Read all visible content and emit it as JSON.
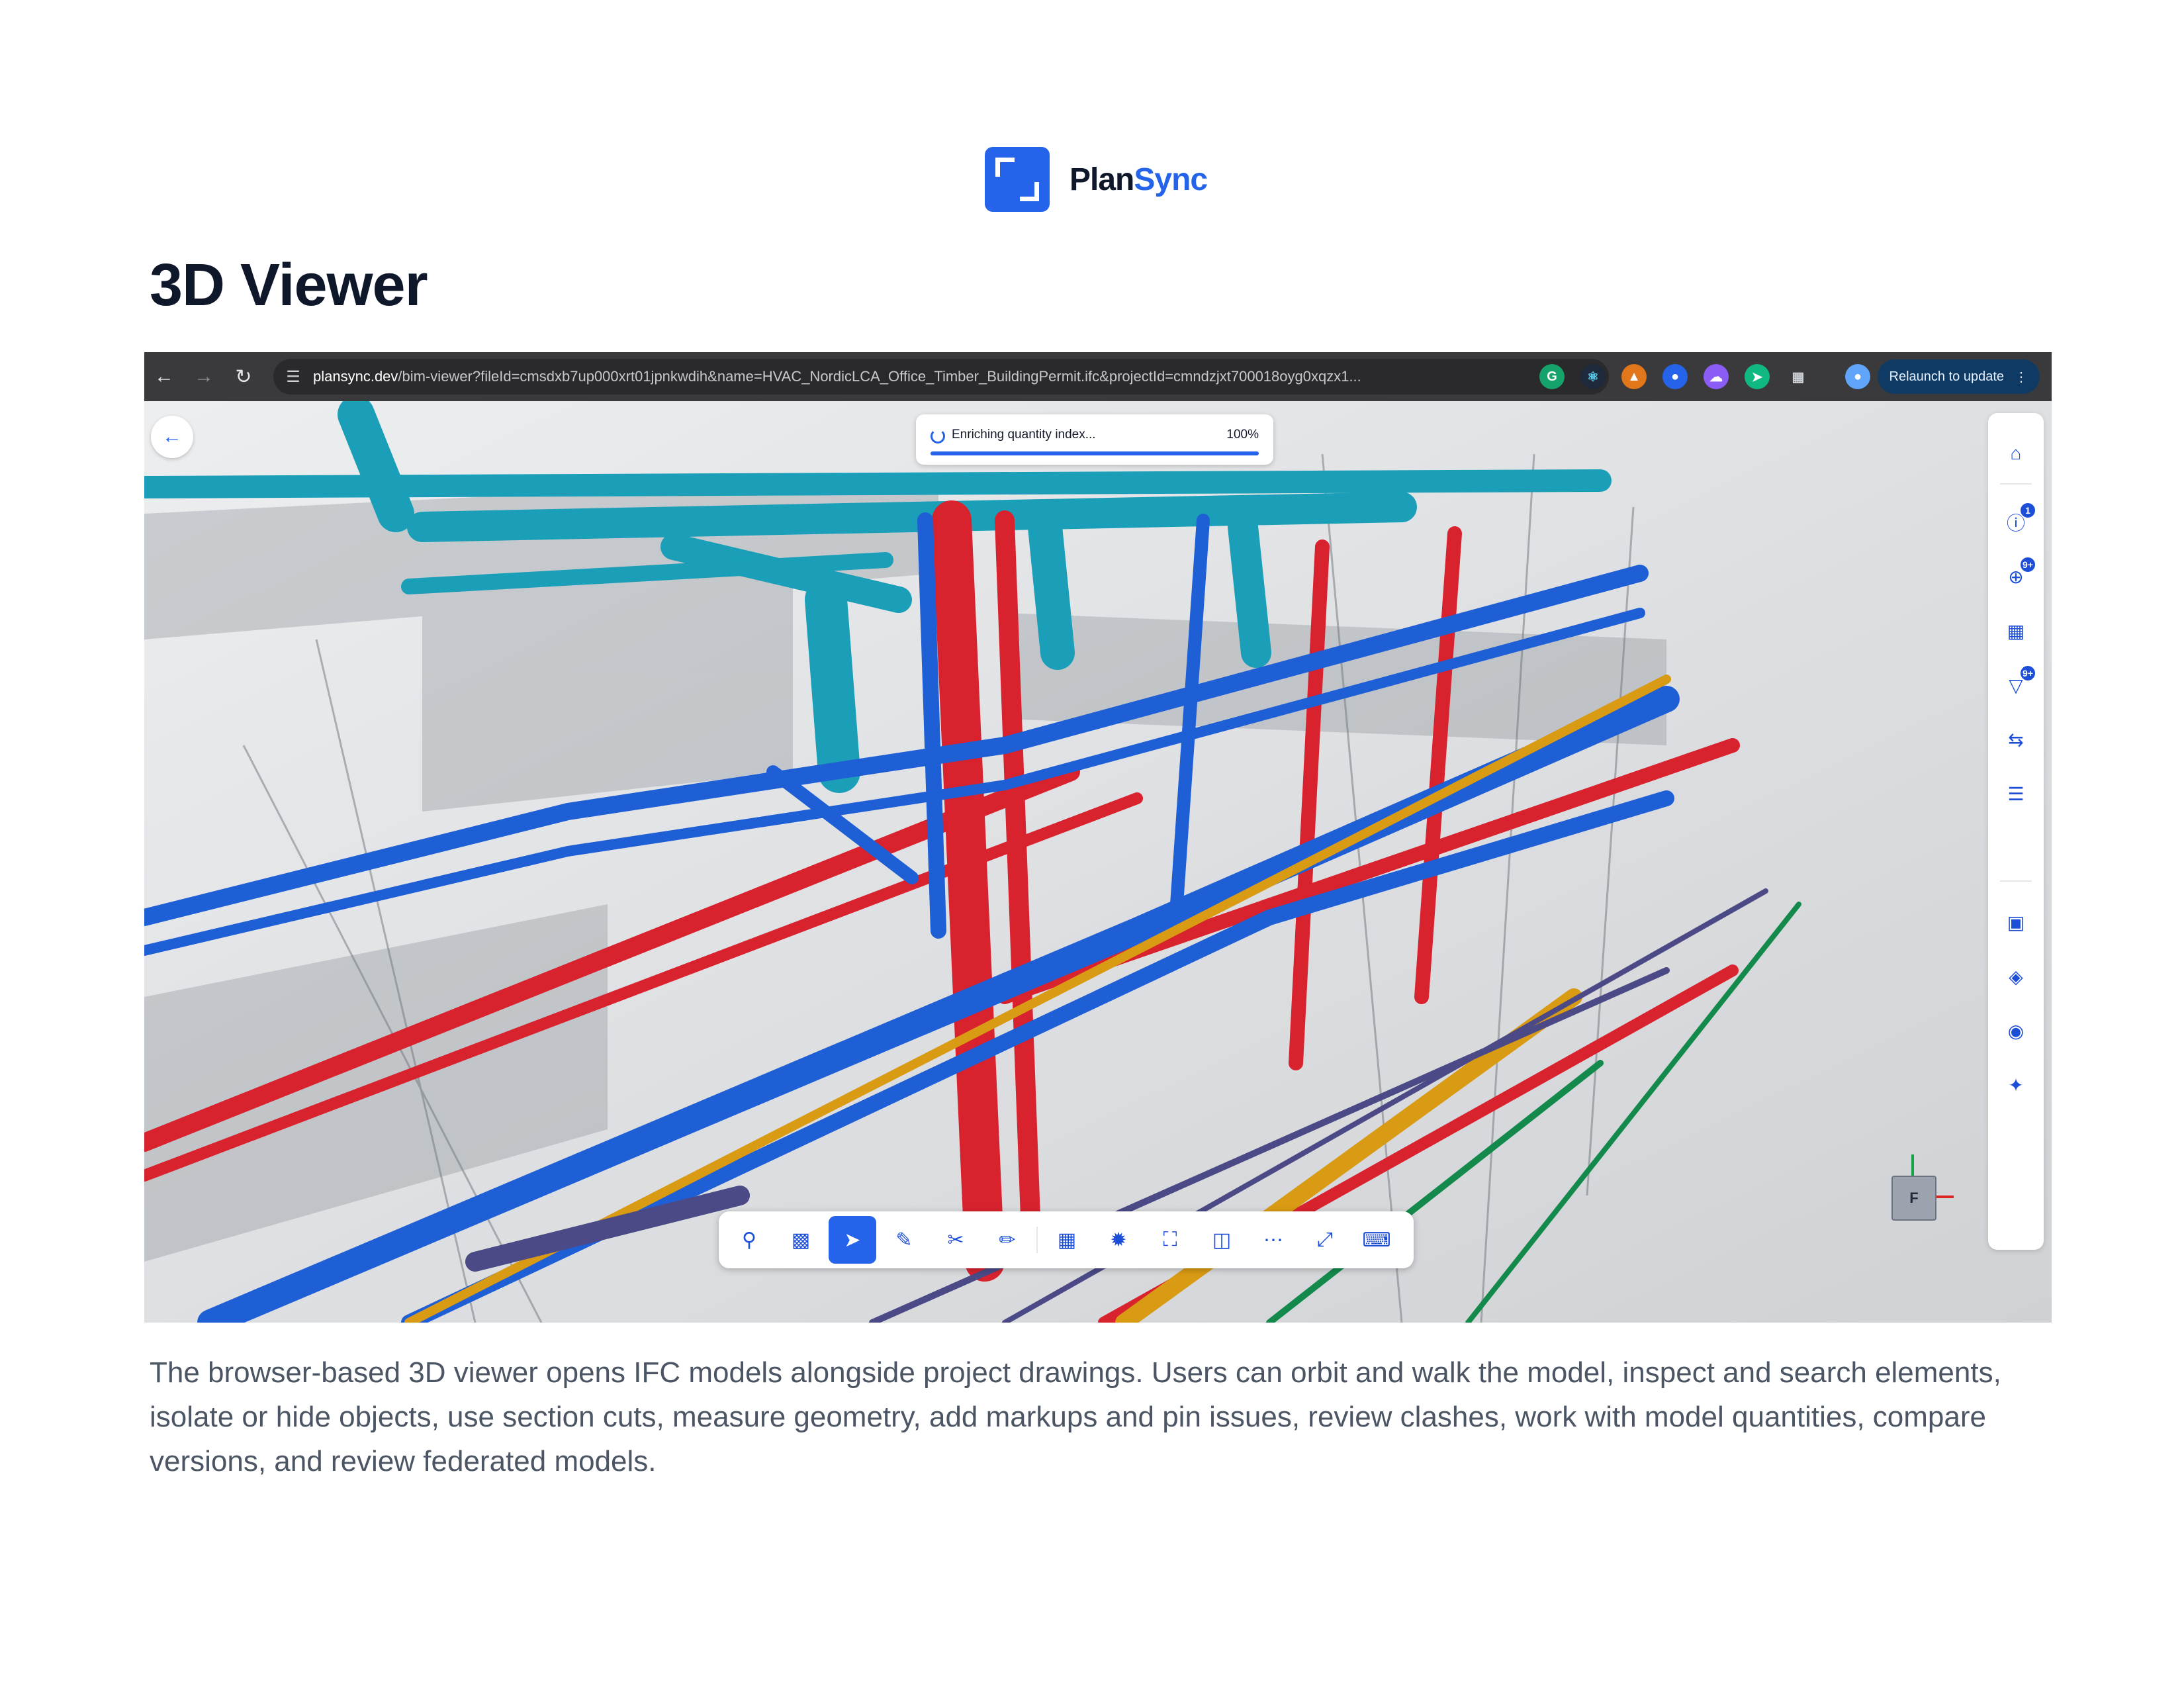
{
  "brand": {
    "name_part1": "Plan",
    "name_part2": "Sync"
  },
  "page_title": "3D Viewer",
  "browser": {
    "url_host": "plansync.dev",
    "url_path": "/bim-viewer?fileId=cmsdxb7up000xrt01jpnkwdih&name=HVAC_NordicLCA_Office_Timber_BuildingPermit.ifc&projectId=cmndzjxt700018oyg0xqzx1...",
    "relaunch_label": "Relaunch to update"
  },
  "viewer": {
    "progress": {
      "label": "Enriching quantity index...",
      "percent_text": "100%",
      "value": 1.0
    },
    "rail": {
      "issues_badge": "1",
      "target_badge": "9+",
      "filter_badge": "9+"
    },
    "navcube_face": "F"
  },
  "description": "The browser-based 3D viewer opens IFC models alongside project drawings. Users can orbit and walk the model, inspect and search elements, isolate or hide objects, use section cuts, measure geometry, add markups and pin issues, review clashes, work with model quantities, compare versions, and review federated models.",
  "colors": {
    "accent": "#2563eb",
    "duct": "#1b9fb8",
    "pipe_blue": "#1f5fd6",
    "pipe_red": "#d8232f",
    "pipe_orange": "#d99a14",
    "pipe_green": "#138a4c",
    "pipe_purple": "#4b4a86"
  }
}
